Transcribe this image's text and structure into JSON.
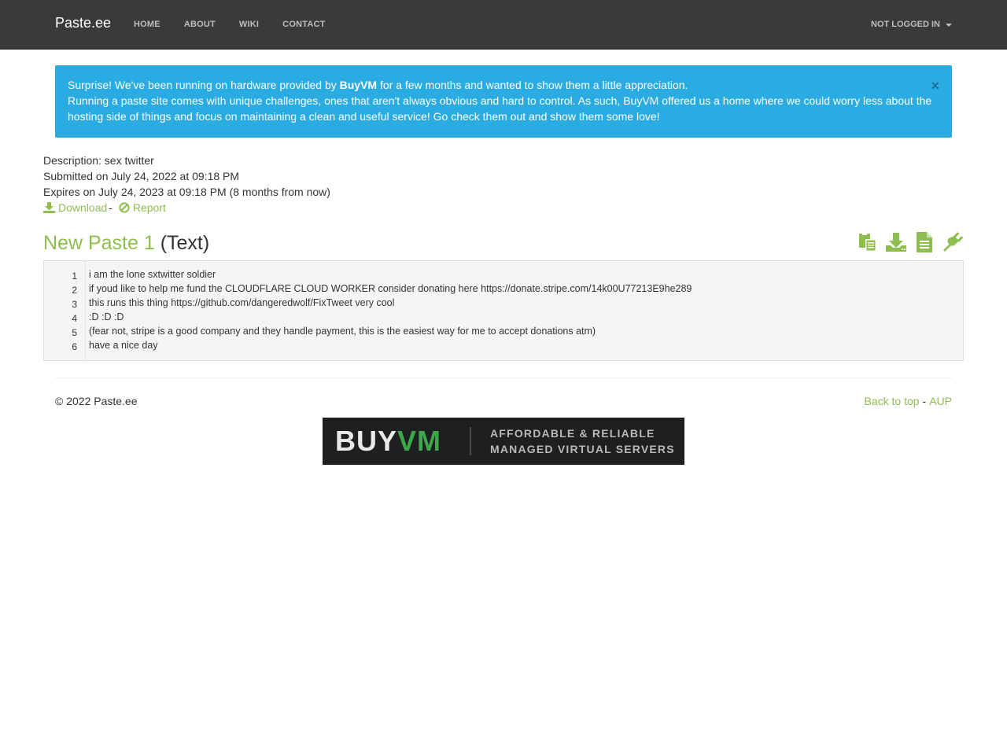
{
  "navbar": {
    "brand": "Paste.ee",
    "links": [
      "HOME",
      "ABOUT",
      "WIKI",
      "CONTACT"
    ],
    "user_menu": "NOT LOGGED IN"
  },
  "alert": {
    "line1_pre": "Surprise! We've been running on hardware provided by ",
    "line1_bold": "BuyVM",
    "line1_post": " for a few months and wanted to show them a little appreciation.",
    "line2": "Running a paste site comes with unique challenges, ones that aren't always obvious and hard to control. As such, BuyVM offered us a home where we could worry less about the hosting side of things and focus on maintaining a clean and useful service! Go check them out and show them some love!",
    "close": "×"
  },
  "meta": {
    "description": "Description: sex twitter",
    "submitted": "Submitted on July 24, 2022 at 09:18 PM",
    "expires": "Expires on July 24, 2023 at 09:18 PM (8 months from now)",
    "download": "Download",
    "separator": "-",
    "report": "Report"
  },
  "paste": {
    "name": "New Paste 1",
    "type": "(Text)",
    "line_numbers": [
      "1",
      "2",
      "3",
      "4",
      "5",
      "6"
    ],
    "lines": [
      "i am the lone sxtwitter soldier",
      "if youd like to help me fund the CLOUDFLARE CLOUD WORKER consider donating here https://donate.stripe.com/14k00U77213E9he289",
      "this runs this thing https://github.com/dangeredwolf/FixTweet very cool",
      ":D :D :D",
      "(fear not, stripe is a good company and they handle payment, this is the easiest way for me to accept donations atm)",
      "have a nice day"
    ]
  },
  "footer": {
    "copyright": "© 2022 Paste.ee",
    "back_to_top": "Back to top",
    "separator": "-",
    "aup": "AUP"
  },
  "banner": {
    "logo_buy": "BUY",
    "logo_vm": "VM",
    "tagline1": "AFFORDABLE & RELIABLE",
    "tagline2": "MANAGED VIRTUAL SERVERS"
  },
  "colors": {
    "accent": "#8ebe4e",
    "navbar": "#3a3a3a",
    "alert": "#2aabe2"
  }
}
